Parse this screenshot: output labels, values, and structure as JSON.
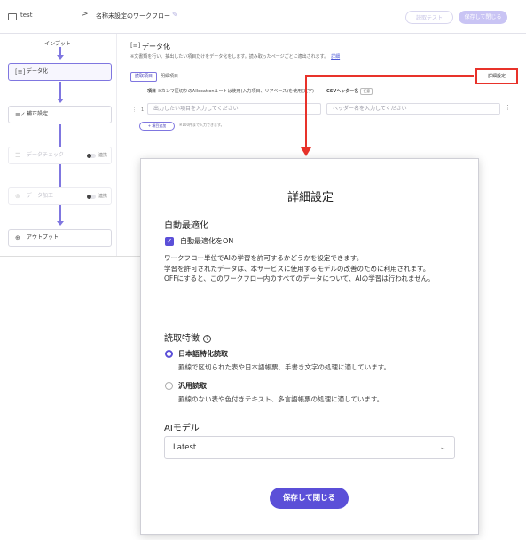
{
  "header": {
    "folder_name": "test",
    "separator": ">",
    "workflow_name": "名称未設定のワークフロー",
    "edit_icon": "pencil-icon",
    "test_button": "読取テスト",
    "save_close_button": "保存して閉じる"
  },
  "flow": {
    "input_label": "インプット",
    "nodes": [
      {
        "label": "データ化",
        "icon": "scan-icon"
      },
      {
        "label": "補正設定",
        "icon": "edit-list-icon"
      },
      {
        "label": "データチェック",
        "icon": "checklist-icon",
        "toggle_label": "連携"
      },
      {
        "label": "データ加工",
        "icon": "process-icon",
        "toggle_label": "連携"
      },
      {
        "label": "アウトプット",
        "icon": "download-icon"
      }
    ]
  },
  "editor": {
    "section_title": "データ化",
    "section_desc": "※文書類を行い、抽出したい項目だけをデータ化をします。読み取ったページごとに適出されます。",
    "section_link": "詳細",
    "tabs": [
      "読取項目",
      "明細項目"
    ],
    "detail_button": "詳細設定",
    "col_item": "項目",
    "col_item_note": "※カンマ区切りのAIlocationルートは使用(入力項目、リアベース)を使用(文字)",
    "col_csv": "CSVヘッダー名",
    "col_csv_badge": "任意",
    "row_number": "1",
    "item_placeholder": "出力したい項目を入力してください",
    "csv_placeholder": "ヘッダー名を入力してください",
    "add_button": "+ 項目追加",
    "add_hint": "※100件まで入力できます。"
  },
  "modal": {
    "title": "詳細設定",
    "auto_opt_title": "自動最適化",
    "auto_opt_checkbox": "自動最適化をON",
    "auto_opt_checked": true,
    "auto_opt_desc1": "ワークフロー単位でAIの学習を許可するかどうかを設定できます。",
    "auto_opt_desc2": "学習を許可されたデータは、本サービスに使用するモデルの改善のために利用されます。",
    "auto_opt_desc3": "OFFにすると、このワークフロー内のすべてのデータについて、AIの学習は行われません。",
    "reading_title": "読取特徴",
    "reading_options": [
      {
        "label": "日本語特化読取",
        "desc": "罫線で区切られた表や日本語帳票、手書き文字の処理に適しています。",
        "selected": true
      },
      {
        "label": "汎用読取",
        "desc": "罫線のない表や色付きテキスト、多言語帳票の処理に適しています。",
        "selected": false
      }
    ],
    "ai_model_title": "AIモデル",
    "ai_model_value": "Latest",
    "save_button": "保存して閉じる"
  },
  "colors": {
    "accent": "#5b4fd8",
    "annotation": "#e8322a"
  }
}
